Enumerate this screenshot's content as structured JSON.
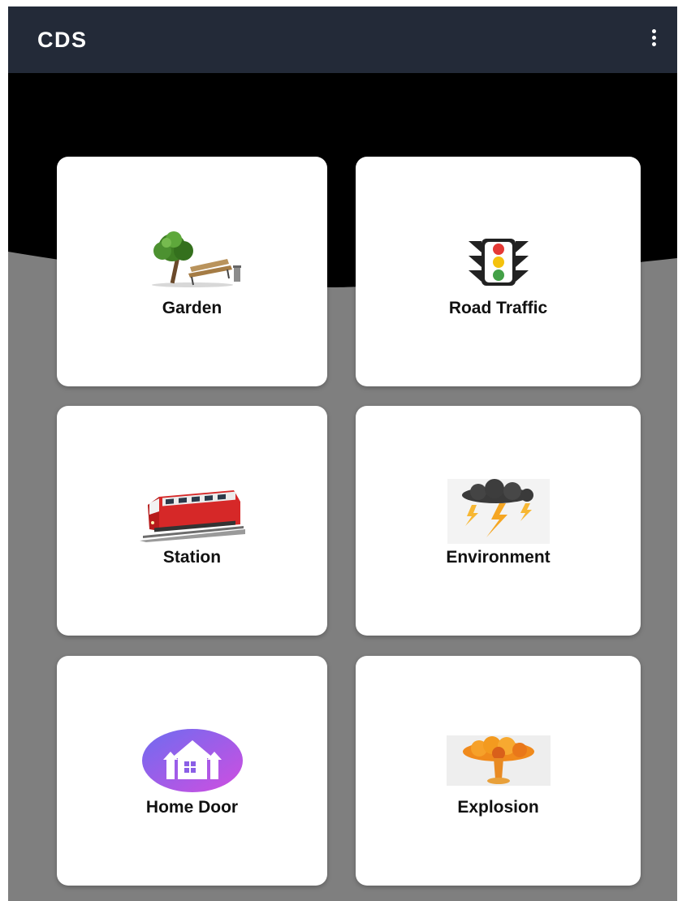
{
  "appbar": {
    "title": "CDS",
    "menu_icon": "more-vert-icon",
    "background": "#232a38"
  },
  "grid": {
    "cards": [
      {
        "label": "Garden",
        "icon": "garden-tree-bench-icon"
      },
      {
        "label": "Road Traffic",
        "icon": "traffic-light-icon"
      },
      {
        "label": "Station",
        "icon": "train-icon"
      },
      {
        "label": "Environment",
        "icon": "storm-cloud-lightning-icon"
      },
      {
        "label": "Home Door",
        "icon": "home-circle-icon"
      },
      {
        "label": "Explosion",
        "icon": "mushroom-cloud-icon"
      }
    ]
  },
  "colors": {
    "hero": "#000000",
    "page_background": "#7f7f7f",
    "card": "#ffffff",
    "home_gradient_start": "#6e6cf0",
    "home_gradient_end": "#d04ee0"
  }
}
